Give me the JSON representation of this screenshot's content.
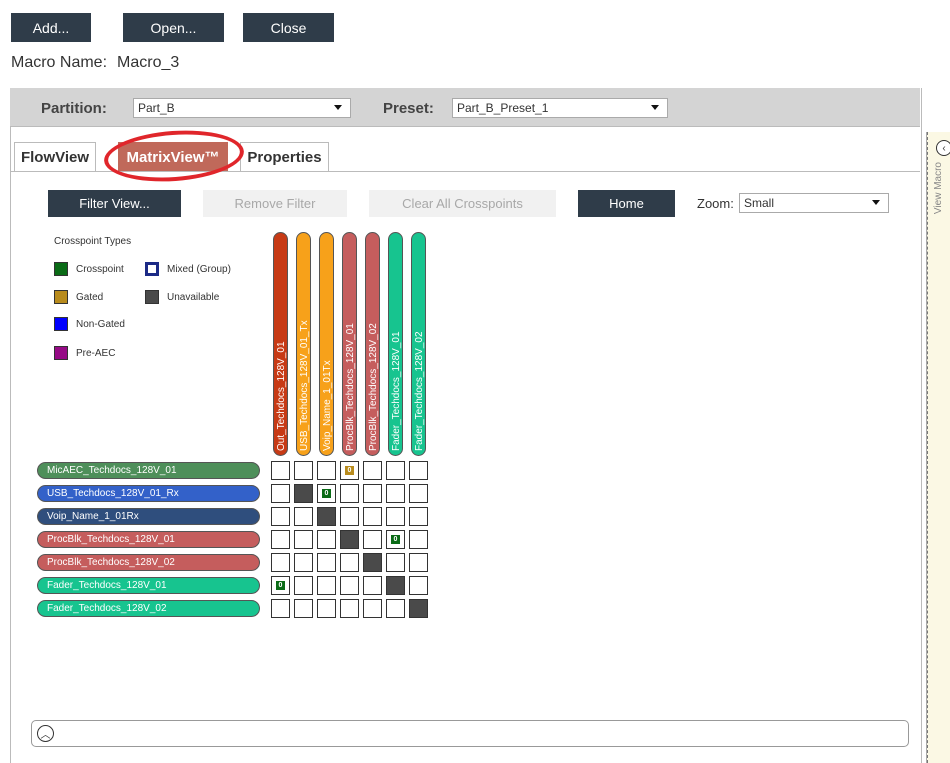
{
  "toolbar": {
    "add_label": "Add...",
    "open_label": "Open...",
    "close_label": "Close"
  },
  "macro": {
    "name_label": "Macro Name:",
    "name_value": "Macro_3"
  },
  "header": {
    "partition_label": "Partition:",
    "partition_value": "Part_B",
    "preset_label": "Preset:",
    "preset_value": "Part_B_Preset_1"
  },
  "tabs": [
    {
      "label": "FlowView"
    },
    {
      "label": "MatrixView™"
    },
    {
      "label": "Properties"
    }
  ],
  "controls": {
    "filter_view": "Filter View...",
    "remove_filter": "Remove Filter",
    "clear_all": "Clear All Crosspoints",
    "home": "Home",
    "zoom_label": "Zoom:",
    "zoom_value": "Small"
  },
  "legend": {
    "title": "Crosspoint Types",
    "items": [
      {
        "label": "Crosspoint",
        "color": "#0a6b16"
      },
      {
        "label": "Mixed (Group)",
        "color": "#1c2a86"
      },
      {
        "label": "Gated",
        "color": "#b88b1c"
      },
      {
        "label": "Unavailable",
        "color": "#4a4a4a"
      },
      {
        "label": "Non-Gated",
        "color": "#0000ff"
      },
      {
        "label": "Pre-AEC",
        "color": "#960a86"
      }
    ]
  },
  "columns": [
    {
      "label": "Out_Techdocs_128V_01",
      "color": "#c73a15"
    },
    {
      "label": "USB_Techdocs_128V_01_Tx",
      "color": "#f7a11a"
    },
    {
      "label": "Voip_Name_1_01Tx",
      "color": "#f7a11a"
    },
    {
      "label": "ProcBlk_Techdocs_128V_01",
      "color": "#c55d5d"
    },
    {
      "label": "ProcBlk_Techdocs_128V_02",
      "color": "#c55d5d"
    },
    {
      "label": "Fader_Techdocs_128V_01",
      "color": "#17c48f"
    },
    {
      "label": "Fader_Techdocs_128V_02",
      "color": "#17c48f"
    }
  ],
  "rows": [
    {
      "label": "MicAEC_Techdocs_128V_01",
      "color": "#4e8f5a"
    },
    {
      "label": "USB_Techdocs_128V_01_Rx",
      "color": "#3361c9"
    },
    {
      "label": "Voip_Name_1_01Rx",
      "color": "#2f4e7d"
    },
    {
      "label": "ProcBlk_Techdocs_128V_01",
      "color": "#c55d5d"
    },
    {
      "label": "ProcBlk_Techdocs_128V_02",
      "color": "#c55d5d"
    },
    {
      "label": "Fader_Techdocs_128V_01",
      "color": "#17c48f"
    },
    {
      "label": "Fader_Techdocs_128V_02",
      "color": "#17c48f"
    }
  ],
  "crosspoints": [
    {
      "row": 0,
      "col": 3,
      "type": "gated",
      "value": "0"
    },
    {
      "row": 1,
      "col": 1,
      "type": "unavailable"
    },
    {
      "row": 1,
      "col": 2,
      "type": "crosspoint",
      "value": "0"
    },
    {
      "row": 2,
      "col": 2,
      "type": "unavailable"
    },
    {
      "row": 3,
      "col": 3,
      "type": "unavailable"
    },
    {
      "row": 3,
      "col": 5,
      "type": "crosspoint",
      "value": "0"
    },
    {
      "row": 4,
      "col": 4,
      "type": "unavailable"
    },
    {
      "row": 5,
      "col": 0,
      "type": "crosspoint",
      "value": "0"
    },
    {
      "row": 5,
      "col": 5,
      "type": "unavailable"
    },
    {
      "row": 6,
      "col": 6,
      "type": "unavailable"
    }
  ],
  "side_panel": {
    "label": "View Macro"
  }
}
